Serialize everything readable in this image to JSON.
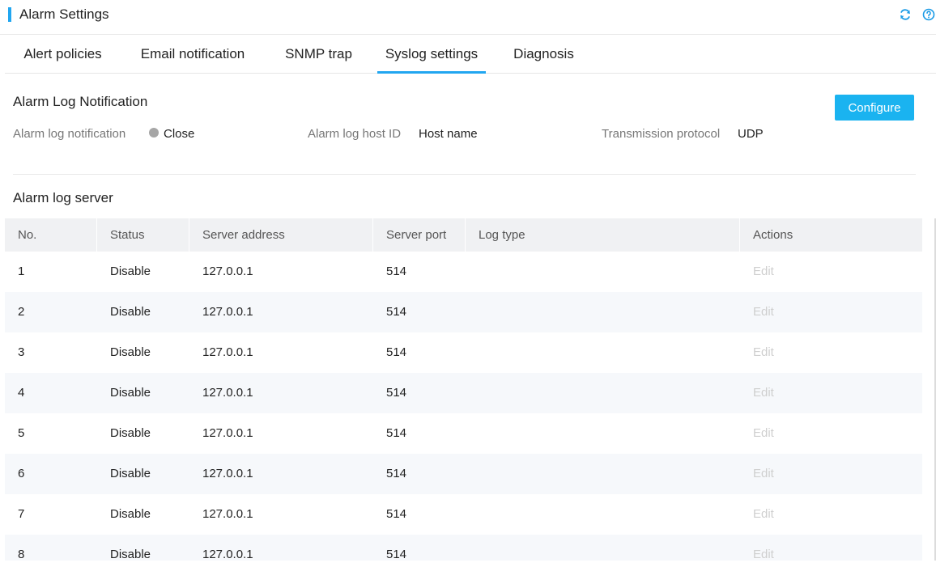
{
  "header": {
    "title": "Alarm Settings",
    "refresh_icon": "refresh-icon",
    "help_icon": "help-icon",
    "accent_color": "#21a6f0"
  },
  "tabs": [
    {
      "label": "Alert policies",
      "active": false
    },
    {
      "label": "Email notification",
      "active": false
    },
    {
      "label": "SNMP trap",
      "active": false
    },
    {
      "label": "Syslog settings",
      "active": true
    },
    {
      "label": "Diagnosis",
      "active": false
    }
  ],
  "notification": {
    "title": "Alarm Log Notification",
    "configure_label": "Configure",
    "notification_label": "Alarm log notification",
    "notification_value": "Close",
    "notification_status_color": "#a6a6a6",
    "host_id_label": "Alarm log host ID",
    "host_id_value": "Host name",
    "protocol_label": "Transmission protocol",
    "protocol_value": "UDP"
  },
  "server": {
    "title": "Alarm log server",
    "columns": [
      "No.",
      "Status",
      "Server address",
      "Server port",
      "Log type",
      "Actions"
    ],
    "rows": [
      {
        "no": "1",
        "status": "Disable",
        "address": "127.0.0.1",
        "port": "514",
        "log_type": "",
        "action": "Edit"
      },
      {
        "no": "2",
        "status": "Disable",
        "address": "127.0.0.1",
        "port": "514",
        "log_type": "",
        "action": "Edit"
      },
      {
        "no": "3",
        "status": "Disable",
        "address": "127.0.0.1",
        "port": "514",
        "log_type": "",
        "action": "Edit"
      },
      {
        "no": "4",
        "status": "Disable",
        "address": "127.0.0.1",
        "port": "514",
        "log_type": "",
        "action": "Edit"
      },
      {
        "no": "5",
        "status": "Disable",
        "address": "127.0.0.1",
        "port": "514",
        "log_type": "",
        "action": "Edit"
      },
      {
        "no": "6",
        "status": "Disable",
        "address": "127.0.0.1",
        "port": "514",
        "log_type": "",
        "action": "Edit"
      },
      {
        "no": "7",
        "status": "Disable",
        "address": "127.0.0.1",
        "port": "514",
        "log_type": "",
        "action": "Edit"
      },
      {
        "no": "8",
        "status": "Disable",
        "address": "127.0.0.1",
        "port": "514",
        "log_type": "",
        "action": "Edit"
      }
    ]
  }
}
